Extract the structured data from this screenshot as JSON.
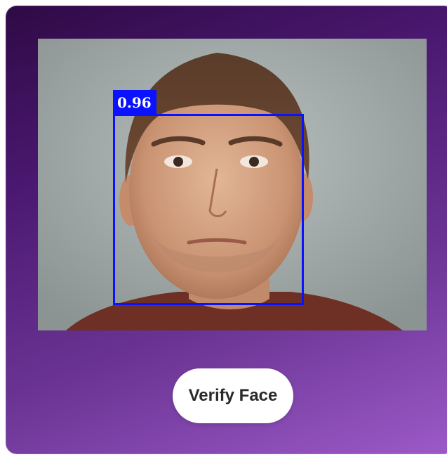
{
  "camera": {
    "detection": {
      "confidence_label": "0.96",
      "box_color": "#0a12ff"
    }
  },
  "actions": {
    "verify_label": "Verify Face"
  },
  "theme": {
    "card_gradient_start": "#2f0a45",
    "card_gradient_end": "#9c5ac8"
  }
}
